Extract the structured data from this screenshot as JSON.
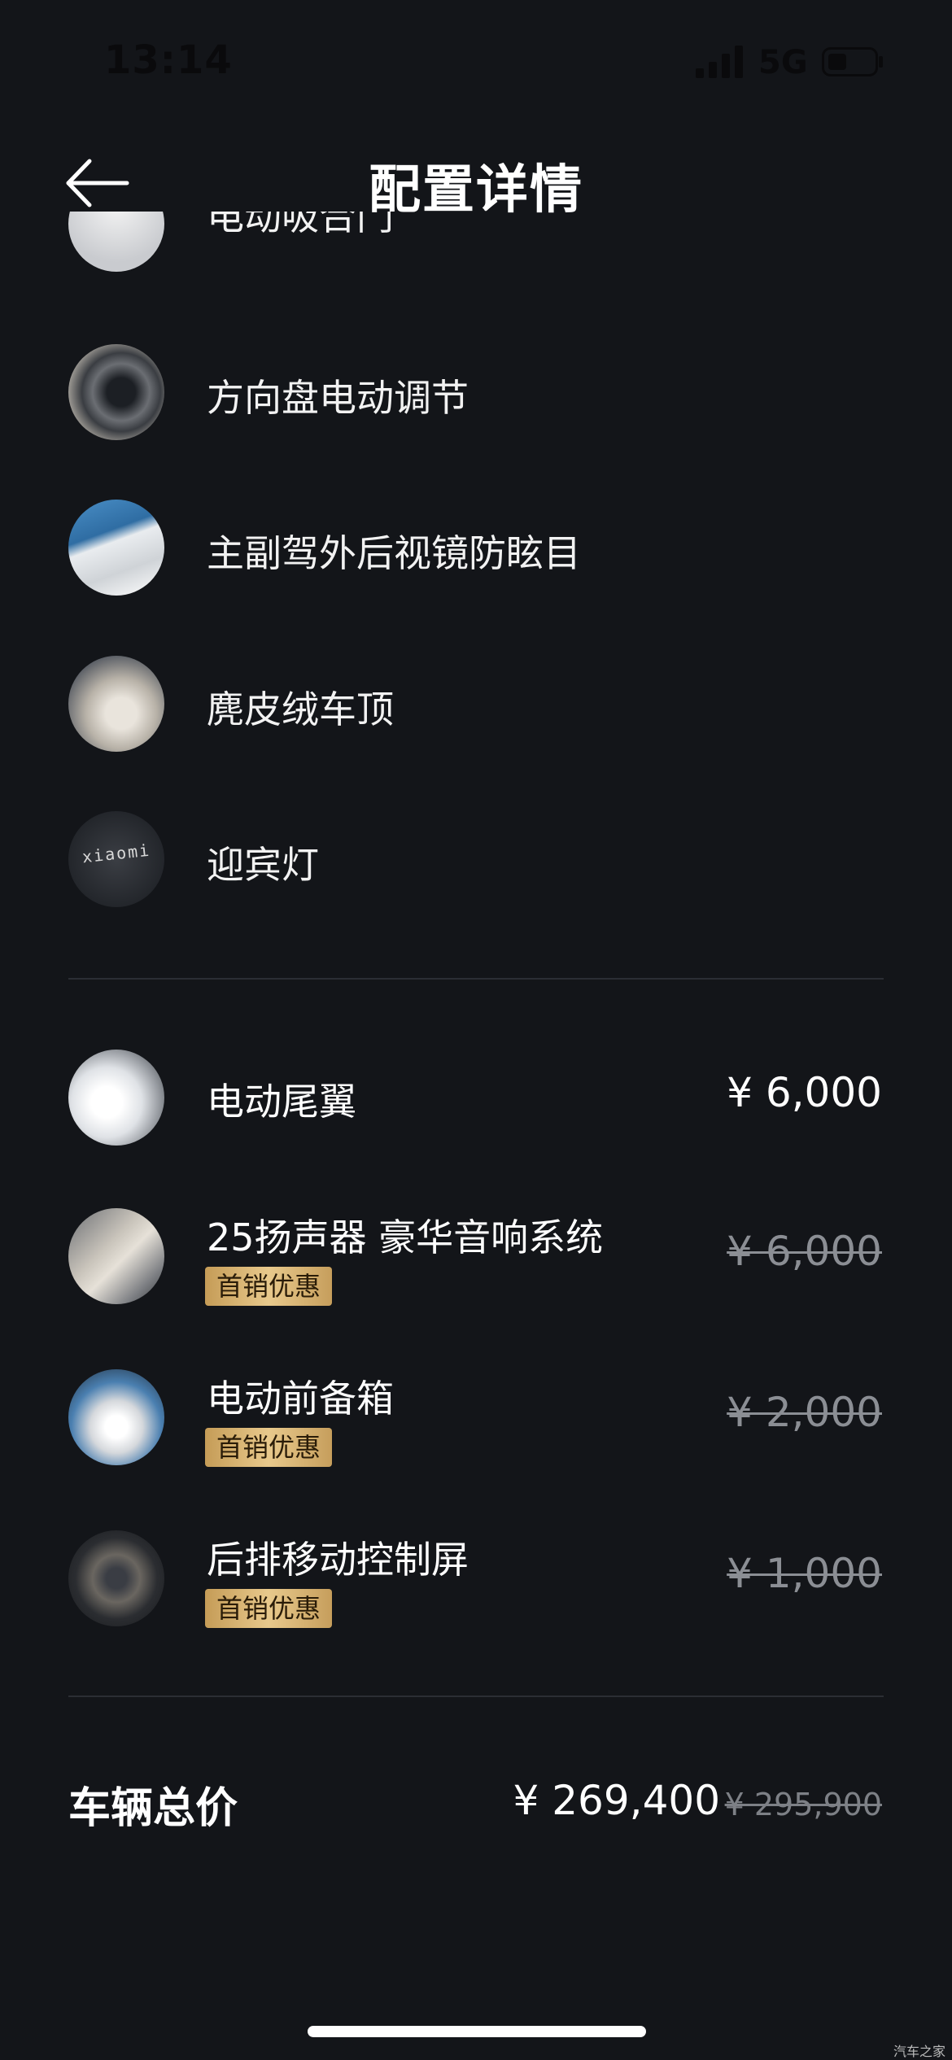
{
  "status_bar": {
    "time": "13:14",
    "network": "5G",
    "signal_icon": "cellular-signal-icon",
    "battery_icon": "battery-icon"
  },
  "header": {
    "back_icon": "arrow-left-icon",
    "title": "配置详情"
  },
  "standard_items": [
    {
      "label": "电动吸合门",
      "thumb": "door-handle-thumb",
      "partially_hidden": true
    },
    {
      "label": "方向盘电动调节",
      "thumb": "steering-wheel-thumb"
    },
    {
      "label": "主副驾外后视镜防眩目",
      "thumb": "side-mirror-thumb"
    },
    {
      "label": "麂皮绒车顶",
      "thumb": "suede-roof-thumb"
    },
    {
      "label": "迎宾灯",
      "thumb": "welcome-light-thumb",
      "thumb_text": "xiaomi"
    }
  ],
  "optional_items": [
    {
      "label": "电动尾翼",
      "price": "¥ 6,000",
      "struck": false,
      "badge": "",
      "thumb": "rear-spoiler-thumb"
    },
    {
      "label": "25扬声器 豪华音响系统",
      "price": "¥ 6,000",
      "struck": true,
      "badge": "首销优惠",
      "thumb": "speaker-thumb"
    },
    {
      "label": "电动前备箱",
      "price": "¥ 2,000",
      "struck": true,
      "badge": "首销优惠",
      "thumb": "front-trunk-thumb"
    },
    {
      "label": "后排移动控制屏",
      "price": "¥ 1,000",
      "struck": true,
      "badge": "首销优惠",
      "thumb": "rear-screen-thumb"
    }
  ],
  "total": {
    "label": "车辆总价",
    "price": "¥ 269,400",
    "original_price": "¥ 295,900"
  },
  "watermark": "汽车之家",
  "colors": {
    "background": "#131519",
    "badge_gold": "#d9b878",
    "struck_gray": "#8b8e94"
  }
}
